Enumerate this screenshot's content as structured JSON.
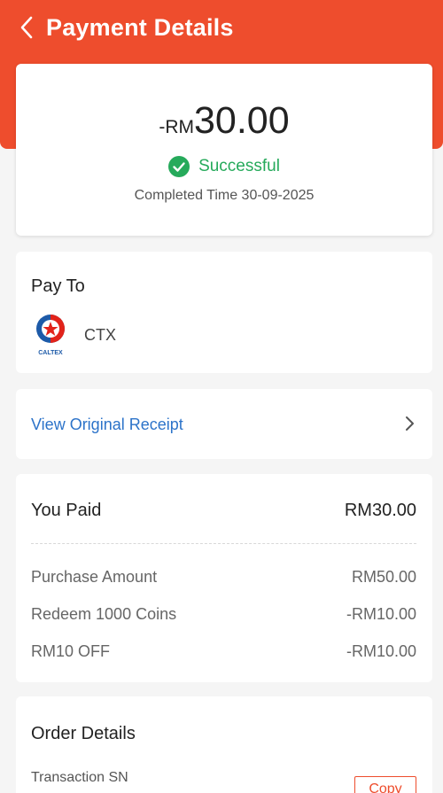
{
  "header": {
    "title": "Payment Details",
    "accent_color": "#ee4d2d"
  },
  "summary": {
    "amount_prefix": "-RM",
    "amount_value": "30.00",
    "status": "Successful",
    "status_color": "#26aa5b",
    "completed_time": "Completed Time 30-09-2025"
  },
  "pay_to": {
    "title": "Pay To",
    "merchant_name": "CTX",
    "merchant_logo_text": "CALTEX"
  },
  "receipt": {
    "label": "View Original Receipt"
  },
  "paid": {
    "title": "You Paid",
    "total": "RM30.00",
    "items": [
      {
        "label": "Purchase Amount",
        "value": "RM50.00"
      },
      {
        "label": "Redeem 1000 Coins",
        "value": "-RM10.00"
      },
      {
        "label": "RM10 OFF",
        "value": "-RM10.00"
      }
    ]
  },
  "order": {
    "title": "Order Details",
    "transaction_sn_label": "Transaction SN",
    "copy_label": "Copy"
  },
  "icons": [
    "back-arrow-icon",
    "check-circle-icon",
    "caltex-logo-icon",
    "chevron-right-icon"
  ]
}
